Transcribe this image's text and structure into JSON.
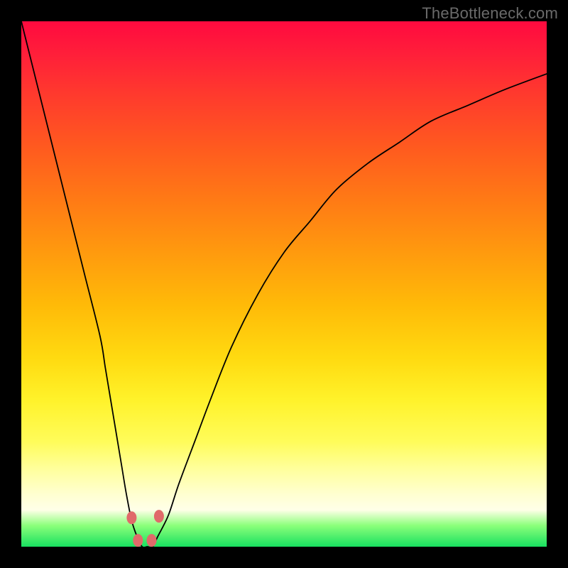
{
  "attribution": "TheBottleneck.com",
  "chart_data": {
    "type": "line",
    "title": "",
    "xlabel": "",
    "ylabel": "",
    "xlim": [
      0,
      100
    ],
    "ylim": [
      0,
      100
    ],
    "grid": false,
    "legend": false,
    "series": [
      {
        "name": "bottleneck-curve",
        "x": [
          0,
          3,
          6,
          9,
          12,
          15,
          16,
          17,
          18,
          19,
          20,
          21,
          22,
          23,
          24,
          25,
          26,
          28,
          30,
          33,
          36,
          40,
          45,
          50,
          55,
          60,
          66,
          72,
          78,
          85,
          92,
          100
        ],
        "y": [
          100,
          88,
          76,
          64,
          52,
          40,
          34,
          28,
          22,
          16,
          10,
          5,
          2,
          0,
          0,
          0,
          2,
          6,
          12,
          20,
          28,
          38,
          48,
          56,
          62,
          68,
          73,
          77,
          81,
          84,
          87,
          90
        ]
      }
    ],
    "markers": [
      {
        "x": 21.0,
        "y": 5.5
      },
      {
        "x": 22.2,
        "y": 1.2
      },
      {
        "x": 24.8,
        "y": 1.2
      },
      {
        "x": 26.2,
        "y": 5.8
      }
    ],
    "background_gradient": {
      "top": "#ff0a3f",
      "bottom": "#18e060",
      "stops": [
        "red",
        "orange",
        "yellow",
        "pale-yellow",
        "green"
      ]
    }
  }
}
